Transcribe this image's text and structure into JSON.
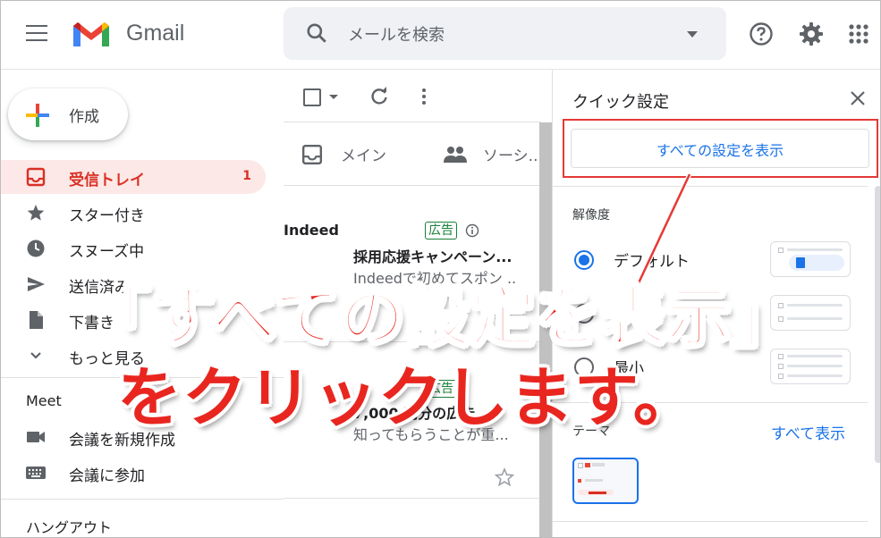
{
  "header": {
    "app_name": "Gmail",
    "search_placeholder": "メールを検索"
  },
  "sidebar": {
    "compose_label": "作成",
    "items": [
      {
        "label": "受信トレイ",
        "count": "1",
        "icon": "inbox-icon"
      },
      {
        "label": "スター付き",
        "icon": "star-icon"
      },
      {
        "label": "スヌーズ中",
        "icon": "clock-icon"
      },
      {
        "label": "送信済み",
        "icon": "send-icon"
      },
      {
        "label": "下書き",
        "icon": "draft-icon"
      },
      {
        "label": "もっと見る",
        "icon": "chevron-down-icon"
      }
    ],
    "meet_title": "Meet",
    "meet_items": [
      {
        "label": "会議を新規作成",
        "icon": "video-icon"
      },
      {
        "label": "会議に参加",
        "icon": "keyboard-icon"
      }
    ],
    "hangouts_title": "ハングアウト"
  },
  "mail_list": {
    "tabs": [
      {
        "label": "メイン",
        "icon": "inbox-tab-icon"
      },
      {
        "label": "ソーシ...",
        "icon": "people-icon"
      }
    ],
    "mails": [
      {
        "sender": "Indeed",
        "badge": "広告",
        "subject": "採用応援キャンペーン...",
        "snippet": "Indeedで初めてスポン..."
      },
      {
        "sender": "",
        "badge": "広告",
        "subject": "7,000 円分の広告...",
        "snippet": "知ってもらうことが重..."
      }
    ]
  },
  "quick_settings": {
    "title": "クイック設定",
    "all_settings_label": "すべての設定を表示",
    "density_title": "解像度",
    "density_options": [
      {
        "label": "デフォルト",
        "checked": true
      },
      {
        "label": "標準",
        "checked": false
      },
      {
        "label": "最小",
        "checked": false
      }
    ],
    "theme_title": "テーマ",
    "theme_link": "すべて表示"
  },
  "overlay": {
    "line1": "「すべての設定を表示」",
    "line2": "をクリックします。",
    "color": "#e8261f"
  },
  "colors": {
    "accent_blue": "#1a73e8",
    "inbox_red": "#d93025",
    "highlight_red": "#e53935"
  }
}
